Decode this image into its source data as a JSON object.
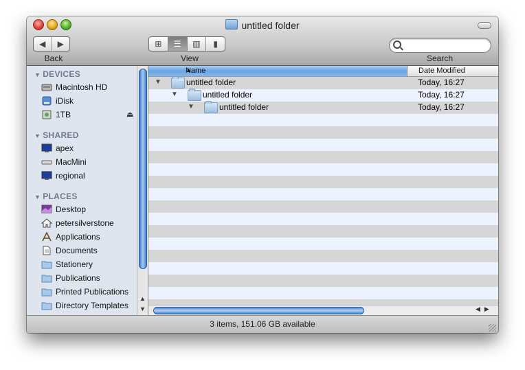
{
  "window": {
    "title": "untitled folder"
  },
  "toolbar": {
    "back_label": "Back",
    "view_label": "View",
    "search_label": "Search",
    "search_placeholder": ""
  },
  "sidebar": {
    "devices_header": "DEVICES",
    "devices": [
      {
        "label": "Macintosh HD",
        "icon": "hard-drive-icon"
      },
      {
        "label": "iDisk",
        "icon": "idisk-icon"
      },
      {
        "label": "1TB",
        "icon": "external-drive-icon"
      }
    ],
    "shared_header": "SHARED",
    "shared": [
      {
        "label": "apex",
        "icon": "monitor-icon"
      },
      {
        "label": "MacMini",
        "icon": "macmini-icon"
      },
      {
        "label": "regional",
        "icon": "monitor-icon"
      }
    ],
    "places_header": "PLACES",
    "places": [
      {
        "label": "Desktop",
        "icon": "desktop-icon"
      },
      {
        "label": "petersilverstone",
        "icon": "home-icon"
      },
      {
        "label": "Applications",
        "icon": "applications-icon"
      },
      {
        "label": "Documents",
        "icon": "document-icon"
      },
      {
        "label": "Stationery",
        "icon": "folder-icon"
      },
      {
        "label": "Publications",
        "icon": "folder-icon"
      },
      {
        "label": "Printed Publications",
        "icon": "folder-icon"
      },
      {
        "label": "Directory Templates",
        "icon": "folder-icon"
      }
    ]
  },
  "list": {
    "columns": {
      "name": "Name",
      "date": "Date Modified"
    },
    "rows": [
      {
        "name": "untitled folder",
        "date": "Today, 16:27",
        "depth": 0
      },
      {
        "name": "untitled folder",
        "date": "Today, 16:27",
        "depth": 1
      },
      {
        "name": "untitled folder",
        "date": "Today, 16:27",
        "depth": 2
      }
    ]
  },
  "status": {
    "text": "3 items, 151.06 GB available"
  },
  "colors": {
    "accent": "#3e7fd2",
    "stripe": "#edf3fe",
    "sidebar_bg": "#dfe5ee"
  }
}
